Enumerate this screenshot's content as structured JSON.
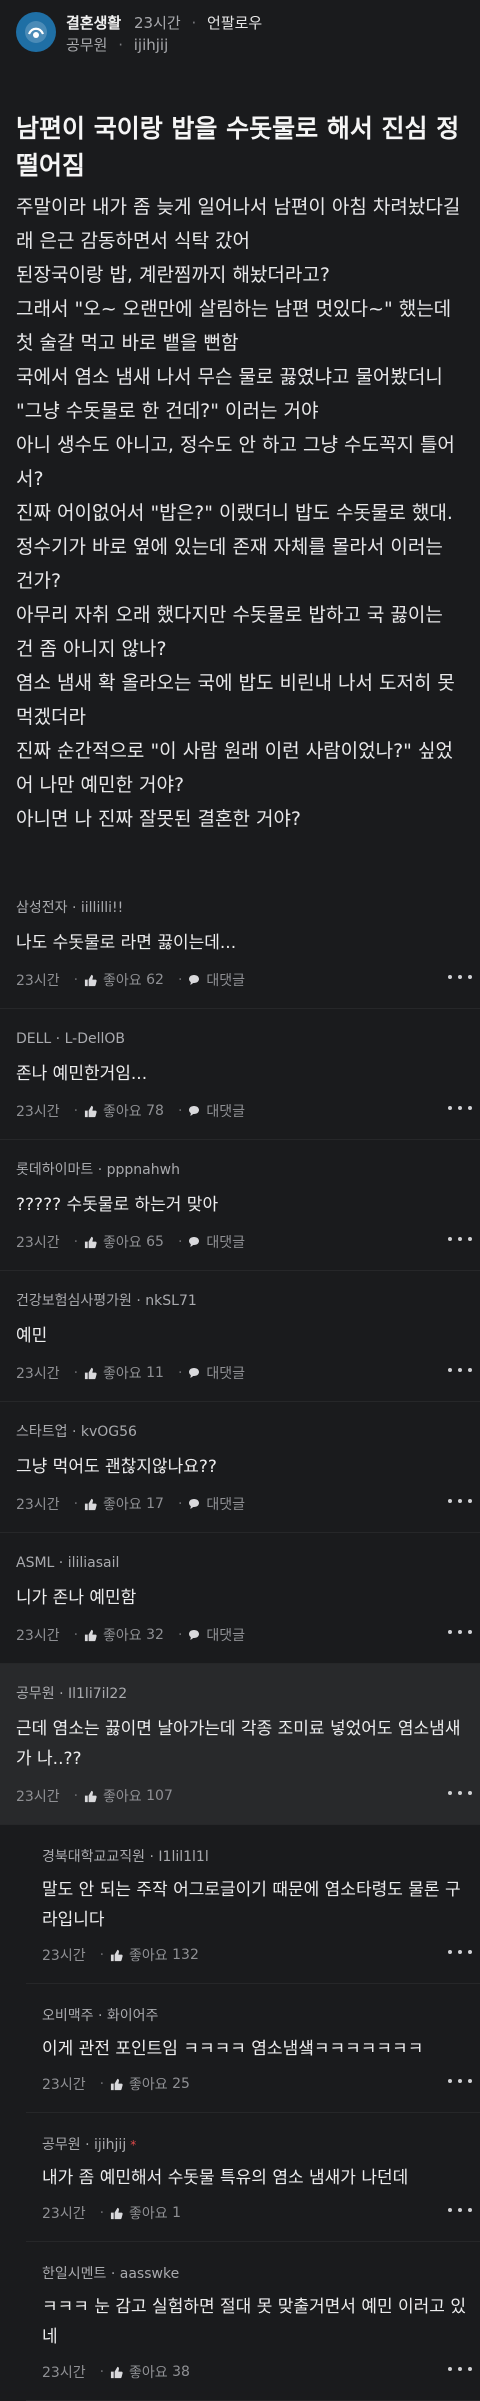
{
  "header": {
    "board": "결혼생활",
    "time": "23시간",
    "action": "언팔로우",
    "author_org": "공무원",
    "author_id": "ijihjij"
  },
  "post": {
    "title": "남편이 국이랑 밥을 수돗물로 해서 진심 정 떨어짐",
    "lines": [
      "주말이라 내가 좀 늦게 일어나서 남편이 아침 차려놨다길래 은근 감동하면서 식탁 갔어",
      "된장국이랑 밥, 계란찜까지 해놨더라고?",
      "그래서 \"오~ 오랜만에 살림하는 남편 멋있다~\" 했는데 첫 술갈 먹고 바로 뱉을 뻔함",
      "국에서 염소 냄새 나서 무슨 물로 끓였냐고 물어봤더니 \"그냥 수돗물로 한 건데?\" 이러는 거야",
      "아니 생수도 아니고, 정수도 안 하고 그냥 수도꼭지 틀어서?",
      "진짜 어이없어서 \"밥은?\" 이랬더니 밥도 수돗물로 했대.",
      "정수기가 바로 옆에 있는데 존재 자체를 몰라서 이러는 건가?",
      "아무리 자취 오래 했다지만 수돗물로 밥하고 국 끓이는 건 좀 아니지 않나?",
      "염소 냄새 확 올라오는 국에 밥도 비린내 나서 도저히 못 먹겠더라",
      "진짜 순간적으로 \"이 사람 원래 이런 사람이었나?\" 싶었어 나만 예민한 거야?",
      "아니면 나 진짜 잘못된 결혼한 거야?"
    ]
  },
  "labels": {
    "like": "좋아요",
    "reply": "대댓글"
  },
  "comments": [
    {
      "org": "삼성전자",
      "id": "iillilli!!",
      "text": "나도 수돗물로 라면 끓이는데...",
      "time": "23시간",
      "likes": "62"
    },
    {
      "org": "DELL",
      "id": "L-DellOB",
      "text": "존나 예민한거임...",
      "time": "23시간",
      "likes": "78"
    },
    {
      "org": "롯데하이마트",
      "id": "pppnahwh",
      "text": "????? 수돗물로 하는거 맞아",
      "time": "23시간",
      "likes": "65"
    },
    {
      "org": "건강보험심사평가원",
      "id": "nkSL71",
      "text": "예민",
      "time": "23시간",
      "likes": "11"
    },
    {
      "org": "스타트업",
      "id": "kvOG56",
      "text": "그냥 먹어도 괜찮지않나요??",
      "time": "23시간",
      "likes": "17"
    },
    {
      "org": "ASML",
      "id": "ililiasail",
      "text": "니가 존나 예민함",
      "time": "23시간",
      "likes": "32"
    }
  ],
  "highlight_comment": {
    "org": "공무원",
    "id": "Il1li7il22",
    "text": "근데 염소는 끓이면 날아가는데 각종 조미료 넣었어도 염소냄새가 나..??",
    "time": "23시간",
    "likes": "107",
    "replies": [
      {
        "org": "경북대학교교직원",
        "id": "I1lil1l1l",
        "text": "말도 안 되는 주작 어그로글이기 때문에 염소타령도 물론 구라입니다",
        "time": "23시간",
        "likes": "132"
      },
      {
        "org": "오비맥주",
        "id": "화이어주",
        "text": "이게 관전 포인트임 ㅋㅋㅋㅋ 염소냄샠ㅋㅋㅋㅋㅋㅋㅋ",
        "time": "23시간",
        "likes": "25"
      },
      {
        "org": "공무원",
        "id": "ijihjij",
        "op": "*",
        "text": "내가 좀 예민해서 수돗물 특유의 염소 냄새가 나던데",
        "time": "23시간",
        "likes": "1"
      },
      {
        "org": "한일시멘트",
        "id": "aasswke",
        "text": "ㅋㅋㅋ 눈 감고 실험하면 절대 못 맞출거면서 예민 이러고 있네",
        "time": "23시간",
        "likes": "38"
      }
    ]
  },
  "colors": {
    "background": "#1a1b1d",
    "logo": "#1f6fa5",
    "op_mark": "#e04a4a"
  },
  "icons": {
    "logo": "board-logo-icon",
    "like": "thumbs-up-icon",
    "reply": "speech-bubble-icon",
    "more": "more-dots-icon"
  }
}
